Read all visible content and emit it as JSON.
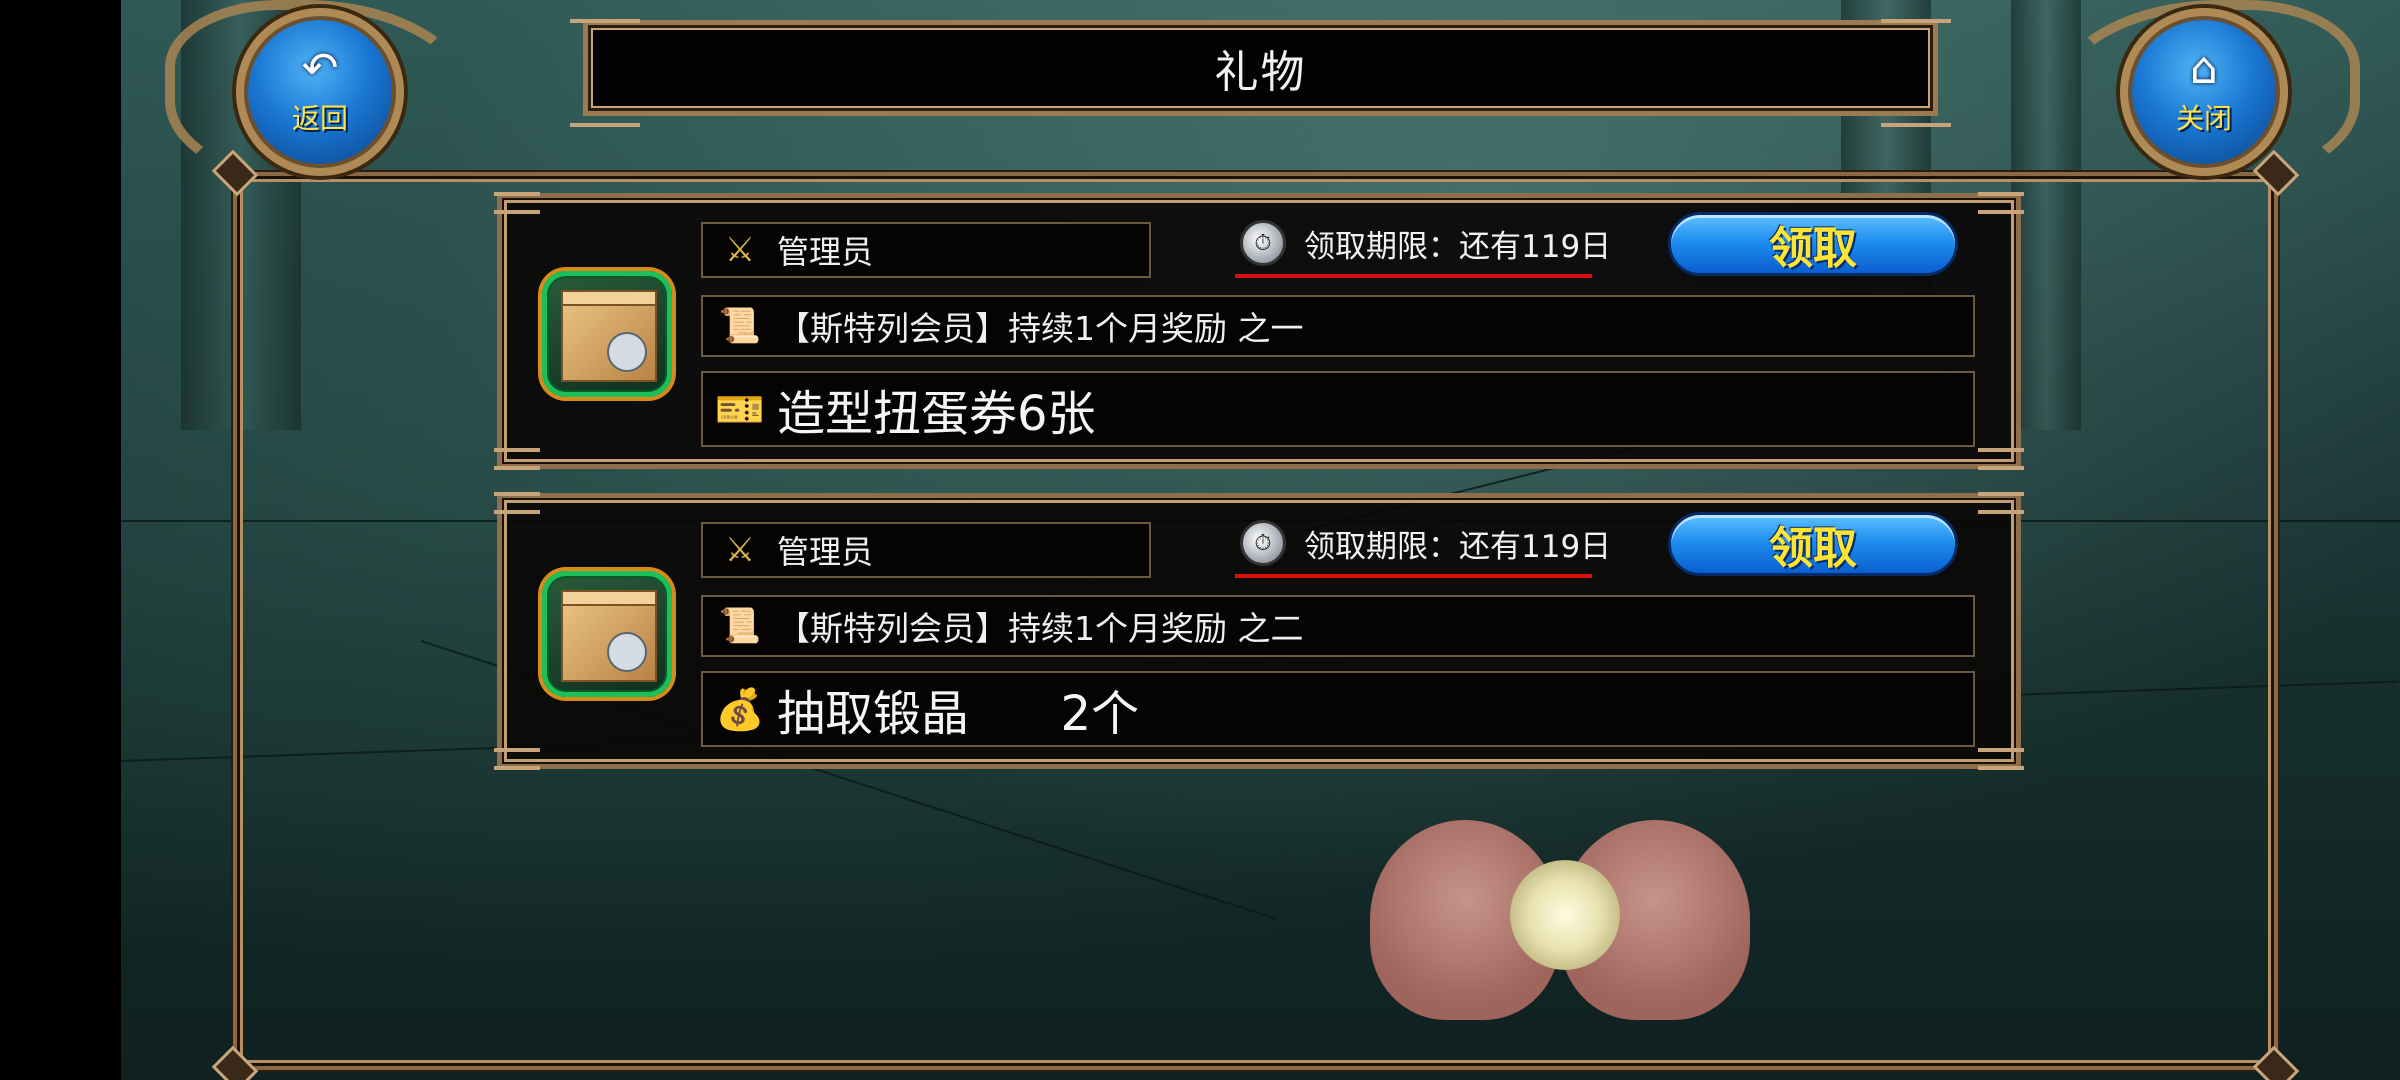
{
  "header": {
    "title": "礼物",
    "back_label": "返回",
    "close_label": "关闭",
    "back_icon": "undo-arrow-icon",
    "close_icon": "home-icon"
  },
  "gifts": [
    {
      "sender": "管理员",
      "sender_icon": "sword-shield-icon",
      "deadline": "领取期限：还有119日",
      "claim_label": "领取",
      "title": "【斯特列会员】持续1个月奖励  之一",
      "title_icon": "scroll-quill-icon",
      "item": "造型扭蛋券6张",
      "item_icon": "gacha-ticket-icon"
    },
    {
      "sender": "管理员",
      "sender_icon": "sword-shield-icon",
      "deadline": "领取期限：还有119日",
      "claim_label": "领取",
      "title": "【斯特列会员】持续1个月奖励  之二",
      "title_icon": "scroll-quill-icon",
      "item": "抽取锻晶      2个",
      "item_icon": "crystal-pouch-icon"
    }
  ],
  "colors": {
    "frame_gold": "#c8a47a",
    "claim_button_blue": "#1e8ef0",
    "claim_text_yellow": "#ffe533",
    "deadline_underline": "#d91010",
    "gift_icon_border": "#1cc05a"
  }
}
